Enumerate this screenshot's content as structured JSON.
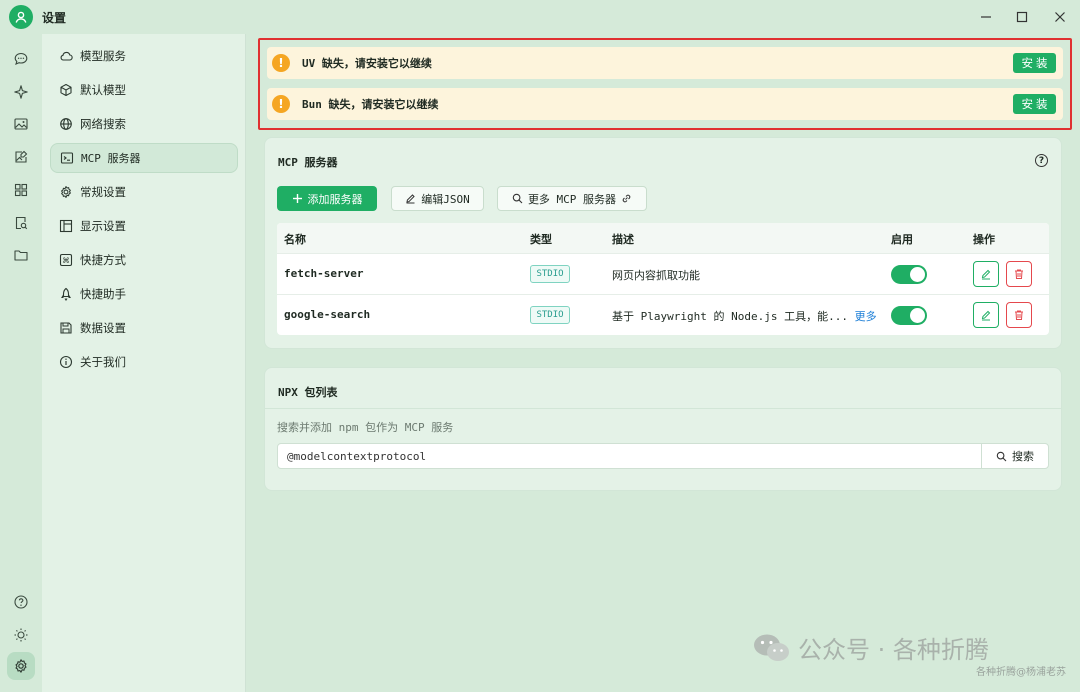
{
  "window": {
    "title": "设置",
    "controls": [
      "minimize",
      "maximize",
      "close"
    ]
  },
  "rail": {
    "top_icons": [
      "chat-icon",
      "sparkle-icon",
      "image-icon",
      "image-edit-icon",
      "apps-icon",
      "doc-search-icon",
      "folder-icon"
    ],
    "bottom_icons": [
      "help-icon",
      "theme-sun-icon",
      "settings-icon"
    ]
  },
  "sidebar": {
    "items": [
      {
        "label": "模型服务",
        "icon": "cloud-icon"
      },
      {
        "label": "默认模型",
        "icon": "cube-icon"
      },
      {
        "label": "网络搜索",
        "icon": "globe-icon"
      },
      {
        "label": "MCP 服务器",
        "icon": "terminal-icon",
        "active": true
      },
      {
        "label": "常规设置",
        "icon": "gear-icon"
      },
      {
        "label": "显示设置",
        "icon": "layout-icon"
      },
      {
        "label": "快捷方式",
        "icon": "command-icon"
      },
      {
        "label": "快捷助手",
        "icon": "rocket-icon"
      },
      {
        "label": "数据设置",
        "icon": "save-icon"
      },
      {
        "label": "关于我们",
        "icon": "info-icon"
      }
    ]
  },
  "alerts": [
    {
      "text": "UV 缺失，请安装它以继续",
      "button": "安装"
    },
    {
      "text": "Bun 缺失，请安装它以继续",
      "button": "安装"
    }
  ],
  "mcp": {
    "title": "MCP 服务器",
    "add_button": "添加服务器",
    "edit_json_button": "编辑JSON",
    "more_button": "更多 MCP 服务器",
    "columns": [
      "名称",
      "类型",
      "描述",
      "启用",
      "操作"
    ],
    "rows": [
      {
        "name": "fetch-server",
        "type": "STDIO",
        "desc": "网页内容抓取功能",
        "more": "",
        "enabled": true
      },
      {
        "name": "google-search",
        "type": "STDIO",
        "desc": "基于 Playwright 的 Node.js 工具，能...",
        "more": "更多",
        "enabled": true
      }
    ]
  },
  "npx": {
    "title": "NPX 包列表",
    "subtitle": "搜索并添加 npm 包作为 MCP 服务",
    "search_value": "@modelcontextprotocol",
    "search_button": "搜索"
  },
  "watermark": {
    "main": "公众号 · 各种折腾",
    "sub": "各种折腾@杨浦老苏"
  },
  "colors": {
    "accent": "#1fae64",
    "warning": "#f5a623",
    "danger": "#e5484d",
    "highlight_box": "#e03131",
    "background": "#d5ead9"
  }
}
